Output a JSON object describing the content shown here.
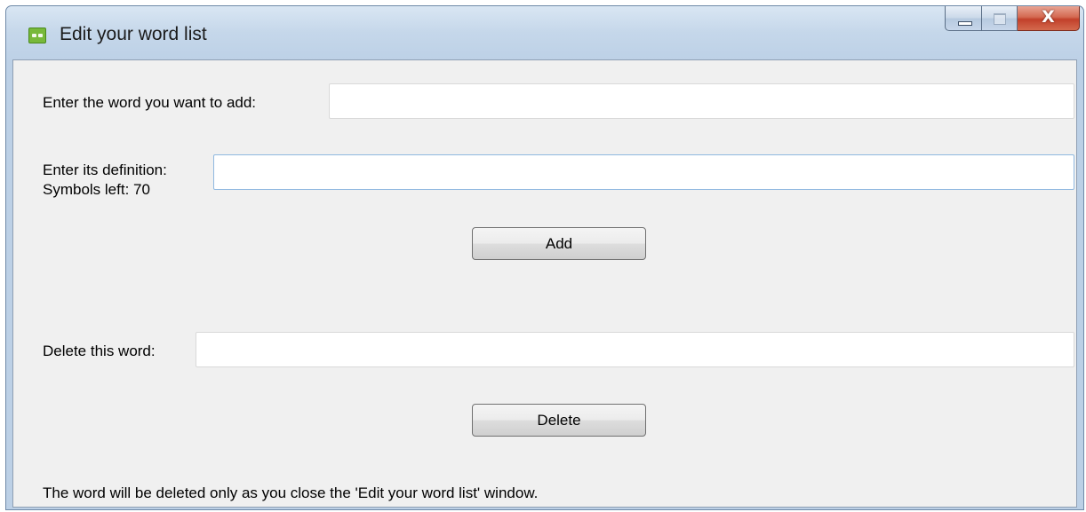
{
  "window": {
    "title": "Edit your word list",
    "icon": "word-list-app-icon"
  },
  "caption_buttons": {
    "close_glyph": "X"
  },
  "add_section": {
    "word_label": "Enter the word you want to add:",
    "word_value": "",
    "definition_label": "Enter its definition:",
    "symbols_left_label": "Symbols left: 70",
    "definition_value": "",
    "add_button_label": "Add"
  },
  "delete_section": {
    "word_label": "Delete this word:",
    "word_value": "",
    "delete_button_label": "Delete"
  },
  "footer_note": "The word will be deleted only as you close the 'Edit your word list' window.",
  "colors": {
    "frame": "#bcd0e6",
    "client_background": "#f0f0f0",
    "close_button": "#c2402a",
    "focused_input_border": "#8fb8e0"
  }
}
